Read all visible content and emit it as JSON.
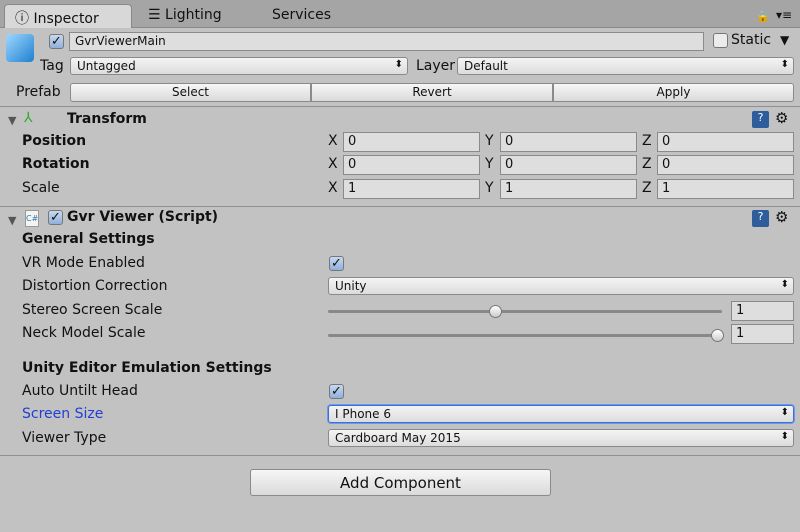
{
  "tabs": [
    {
      "label": "Inspector",
      "icon": "info-icon"
    },
    {
      "label": "Lighting",
      "icon": "sliders-icon"
    },
    {
      "label": "Services"
    }
  ],
  "object": {
    "enabled": true,
    "name": "GvrViewerMain",
    "static_label": "Static",
    "static": false,
    "tag_label": "Tag",
    "tag": "Untagged",
    "layer_label": "Layer",
    "layer": "Default",
    "prefab_label": "Prefab",
    "select": "Select",
    "revert": "Revert",
    "apply": "Apply"
  },
  "transform": {
    "title": "Transform",
    "rows": [
      {
        "label": "Position",
        "x": "0",
        "y": "0",
        "z": "0"
      },
      {
        "label": "Rotation",
        "x": "0",
        "y": "0",
        "z": "0"
      },
      {
        "label": "Scale",
        "x": "1",
        "y": "1",
        "z": "1"
      }
    ],
    "axes": [
      "X",
      "Y",
      "Z"
    ]
  },
  "script": {
    "title": "Gvr Viewer (Script)",
    "enabled": true,
    "general": "General Settings",
    "vr_label": "VR Mode Enabled",
    "vr": true,
    "distortion_label": "Distortion Correction",
    "distortion": "Unity",
    "stereo_label": "Stereo Screen Scale",
    "stereo": "1",
    "stereo_fraction": 0.43,
    "neck_label": "Neck Model Scale",
    "neck": "1",
    "neck_fraction": 1.0,
    "emulation": "Unity Editor Emulation Settings",
    "untilt_label": "Auto Untilt Head",
    "untilt": true,
    "screen_label": "Screen Size",
    "screen": "I Phone 6",
    "viewer_label": "Viewer Type",
    "viewer": "Cardboard May 2015"
  },
  "add_component": "Add Component",
  "colors": {
    "highlight_label": "#1f3fd6",
    "focus_border": "#3d6fd8"
  }
}
